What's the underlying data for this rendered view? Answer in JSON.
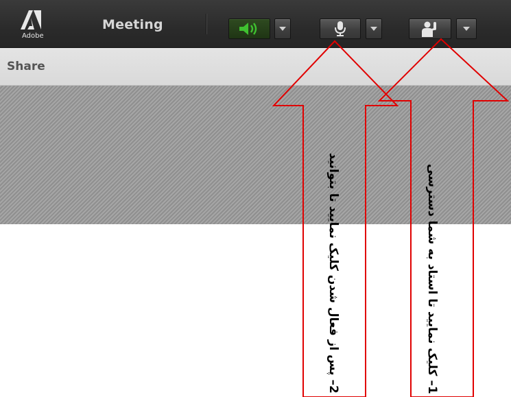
{
  "toolbar": {
    "logo_text": "Adobe",
    "app_title": "Meeting",
    "speaker_icon": "speaker-icon",
    "microphone_icon": "microphone-icon",
    "raise_hand_icon": "raise-hand-icon",
    "speaker_active_color": "#3fc130"
  },
  "share_pod": {
    "title": "Share"
  },
  "annotations": {
    "step1_text": "1– کلیک نمایید تا استاد به شما دسترسی",
    "step2_text": "2– پس از فعال شدن کلیک نمایید تا بتوانید",
    "arrow_color": "#e00000"
  }
}
